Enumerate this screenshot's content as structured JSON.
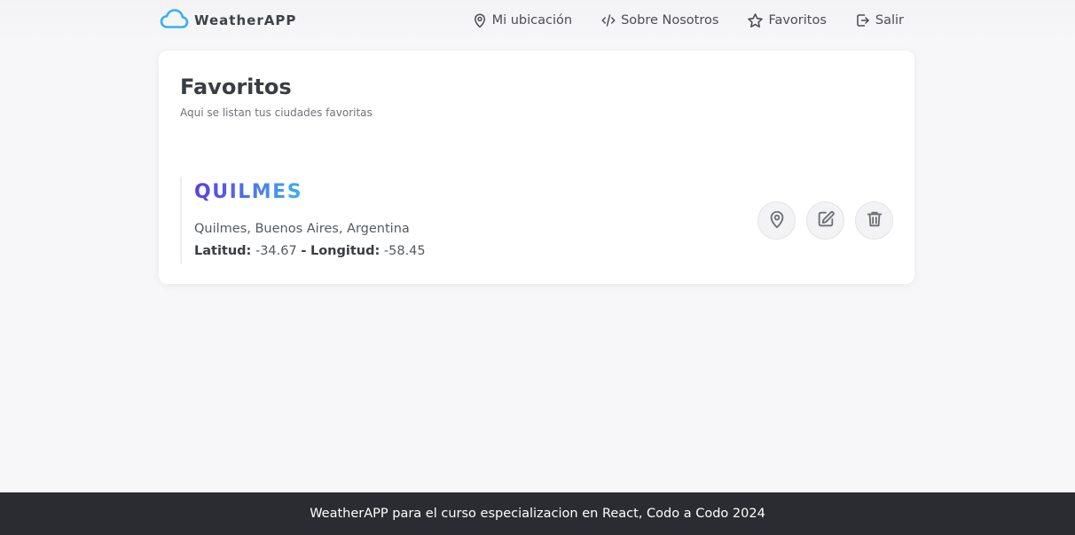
{
  "brand": {
    "name": "WeatherAPP",
    "icon": "cloud-icon",
    "accent": "#3ab0f0"
  },
  "nav": {
    "items": [
      {
        "label": "Mi ubicación",
        "icon": "map-pin-icon"
      },
      {
        "label": "Sobre Nosotros",
        "icon": "code-icon"
      },
      {
        "label": "Favoritos",
        "icon": "star-icon"
      },
      {
        "label": "Salir",
        "icon": "logout-icon"
      }
    ]
  },
  "page": {
    "title": "Favoritos",
    "subtitle": "Aqui se listan tus ciudades favoritas"
  },
  "favorites": [
    {
      "name": "QUILMES",
      "full_name": "Quilmes, Buenos Aires, Argentina",
      "lat_label": "Latitud:",
      "lat_value": "-34.67",
      "separator": "-",
      "lon_label": "Longitud:",
      "lon_value": "-58.45",
      "actions": [
        "map-pin-icon",
        "edit-icon",
        "trash-icon"
      ]
    }
  ],
  "footer": {
    "text": "WeatherAPP para el curso especializacion en React, Codo a Codo 2024"
  },
  "colors": {
    "background": "#f7f7f9",
    "footer": "#2b2c31",
    "title_gradient_start": "#5b3fe0",
    "title_gradient_end": "#3fb0f0"
  }
}
